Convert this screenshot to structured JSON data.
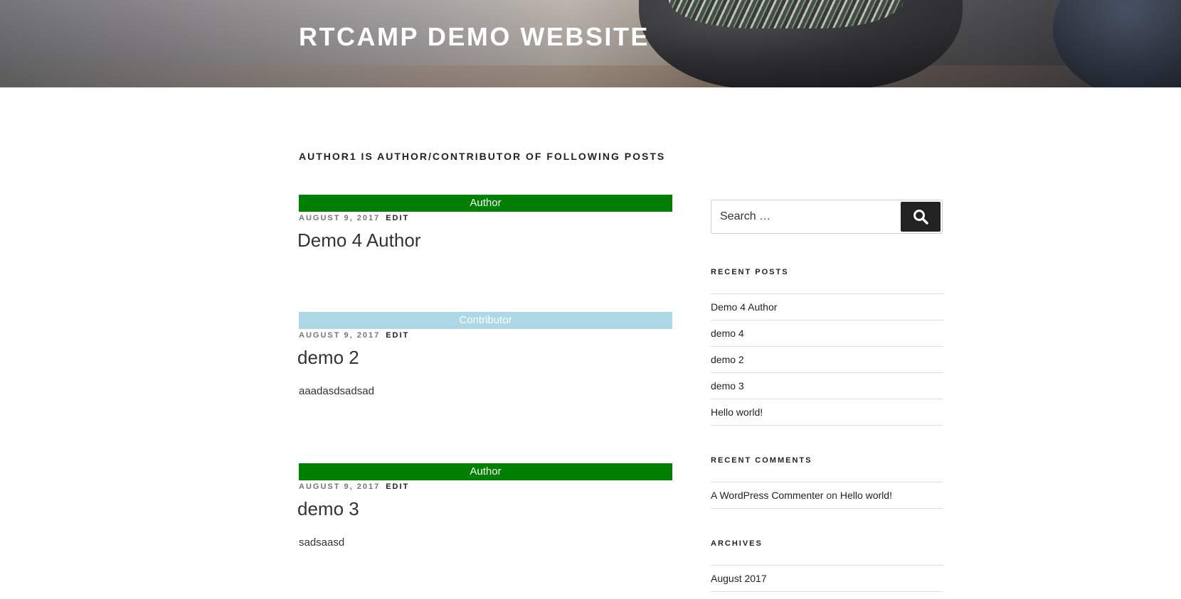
{
  "site": {
    "title": "RTCAMP DEMO WEBSITE"
  },
  "page": {
    "heading": "AUTHOR1 IS AUTHOR/CONTRIBUTOR OF FOLLOWING POSTS"
  },
  "posts": [
    {
      "role": "Author",
      "role_color": "#008000",
      "date": "AUGUST 9, 2017",
      "edit_label": "EDIT",
      "title": "Demo 4 Author",
      "excerpt": ""
    },
    {
      "role": "Contributor",
      "role_color": "#add8e6",
      "date": "AUGUST 9, 2017",
      "edit_label": "EDIT",
      "title": "demo 2",
      "excerpt": "aaadasdsadsad"
    },
    {
      "role": "Author",
      "role_color": "#008000",
      "date": "AUGUST 9, 2017",
      "edit_label": "EDIT",
      "title": "demo 3",
      "excerpt": "sadsaasd"
    }
  ],
  "sidebar": {
    "search": {
      "placeholder": "Search …",
      "icon": "search-icon"
    },
    "recent_posts": {
      "title": "RECENT POSTS",
      "items": [
        "Demo 4 Author",
        "demo 4",
        "demo 2",
        "demo 3",
        "Hello world!"
      ]
    },
    "recent_comments": {
      "title": "RECENT COMMENTS",
      "items": [
        {
          "author": "A WordPress Commenter",
          "on": "on",
          "post": "Hello world!"
        }
      ]
    },
    "archives": {
      "title": "ARCHIVES",
      "items": [
        "August 2017"
      ]
    }
  }
}
